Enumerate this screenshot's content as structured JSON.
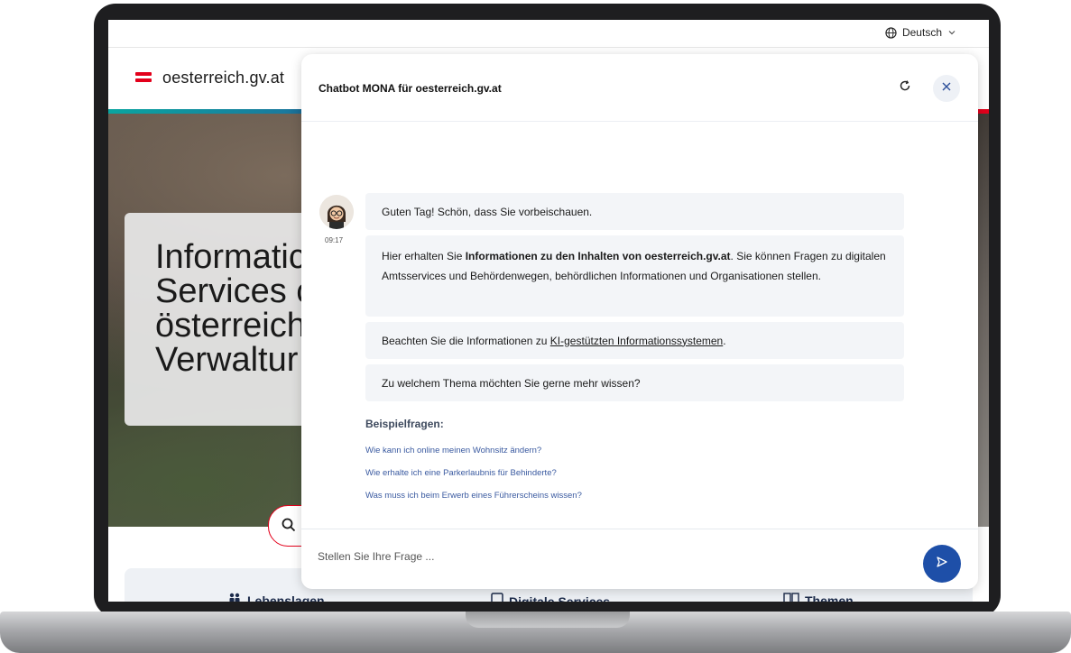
{
  "site": {
    "language_label": "Deutsch",
    "logo_text": "oesterreich.gv.at",
    "hero_title": "Informatic\nServices c\nösterreich\nVerwaltur",
    "tabs": [
      {
        "label": "Lebenslagen"
      },
      {
        "label": "Digitale Services"
      },
      {
        "label": "Themen"
      }
    ]
  },
  "chat": {
    "title": "Chatbot MONA für oesterreich.gv.at",
    "time": "09:17",
    "messages": {
      "m1": "Guten Tag! Schön, dass Sie vorbeischauen.",
      "m2_pre": "Hier erhalten Sie ",
      "m2_bold": "Informationen zu den Inhalten von oesterreich.gv.at",
      "m2_post": ". Sie können Fragen zu digitalen Amtsservices und Behördenwegen, behördlichen Informationen und Organisationen stellen.",
      "m3_pre": "Beachten Sie die Informationen zu ",
      "m3_link": "KI-gestützten Informationssystemen",
      "m3_post": ".",
      "m4": "Zu welchem Thema möchten Sie gerne mehr wissen?"
    },
    "examples_title": "Beispielfragen:",
    "examples": [
      "Wie kann ich online meinen Wohnsitz ändern?",
      "Wie erhalte ich eine Parkerlaubnis für Behinderte?",
      "Was muss ich beim Erwerb eines Führerscheins wissen?"
    ],
    "input_placeholder": "Stellen Sie Ihre Frage ..."
  },
  "colors": {
    "accent_red": "#e3001b",
    "send_button": "#1e4fa8",
    "bubble_bg": "#f3f5f8"
  },
  "icons": [
    "globe-icon",
    "chevron-down-icon",
    "refresh-icon",
    "close-icon",
    "search-icon",
    "send-icon",
    "avatar-icon",
    "people-icon",
    "tablet-icon",
    "book-icon"
  ]
}
